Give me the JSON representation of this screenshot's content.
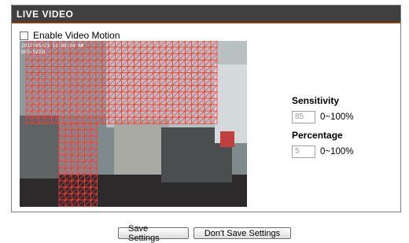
{
  "panel": {
    "title": "LIVE VIDEO"
  },
  "motion": {
    "enable_label": "Enable Video Motion",
    "enabled": false
  },
  "video": {
    "overlay_timestamp": "2017/05/21 11:08:34 AM",
    "overlay_id": "DCS-5222L"
  },
  "sensitivity": {
    "label": "Sensitivity",
    "value": "85",
    "range": "0~100%"
  },
  "percentage": {
    "label": "Percentage",
    "value": "5",
    "range": "0~100%"
  },
  "buttons": {
    "save": "Save Settings",
    "dont_save": "Don't Save Settings"
  },
  "colors": {
    "header_bg": "#404040",
    "grid": "#ff3b3b",
    "accent": "#ff6600"
  }
}
